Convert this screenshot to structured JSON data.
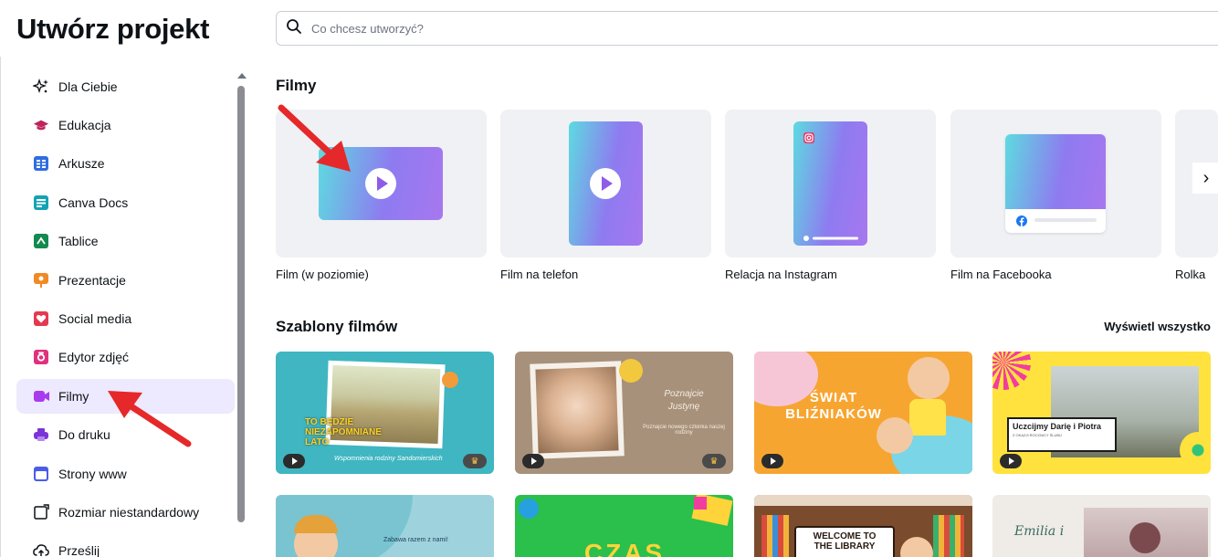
{
  "header": {
    "title": "Utwórz projekt",
    "search_placeholder": "Co chcesz utworzyć?"
  },
  "sidebar": {
    "items": [
      {
        "label": "Dla Ciebie",
        "icon": "sparkle-icon"
      },
      {
        "label": "Edukacja",
        "icon": "graduation-cap-icon"
      },
      {
        "label": "Arkusze",
        "icon": "sheet-icon"
      },
      {
        "label": "Canva Docs",
        "icon": "docs-icon"
      },
      {
        "label": "Tablice",
        "icon": "whiteboard-icon"
      },
      {
        "label": "Prezentacje",
        "icon": "presentation-icon"
      },
      {
        "label": "Social media",
        "icon": "heart-icon"
      },
      {
        "label": "Edytor zdjęć",
        "icon": "camera-icon"
      },
      {
        "label": "Filmy",
        "icon": "video-icon",
        "active": true
      },
      {
        "label": "Do druku",
        "icon": "printer-icon"
      },
      {
        "label": "Strony www",
        "icon": "website-icon"
      },
      {
        "label": "Rozmiar niestandardowy",
        "icon": "custom-size-icon"
      },
      {
        "label": "Prześlij",
        "icon": "upload-icon"
      }
    ]
  },
  "films": {
    "heading": "Filmy",
    "cards": [
      {
        "label": "Film (w poziomie)"
      },
      {
        "label": "Film na telefon"
      },
      {
        "label": "Relacja na Instagram"
      },
      {
        "label": "Film na Facebooka"
      },
      {
        "label": "Rolka"
      }
    ],
    "next_label": "›"
  },
  "templates": {
    "heading": "Szablony filmów",
    "see_all": "Wyświetl wszystko",
    "items": [
      {
        "line1": "TO BĘDZIE",
        "line2": "NIEZAPOMNIANE",
        "line3": "LATO",
        "script": "Wspomnienia rodziny Sandomierskich"
      },
      {
        "line1": "Poznajcie",
        "line2": "Justynę",
        "line3": "Poznajcie nowego członka naszej rodziny"
      },
      {
        "line1": "ŚWIAT",
        "line2": "BLIŹNIAKÓW"
      },
      {
        "line1": "Uczcijmy Darię i Piotra",
        "line2": "Z OKAZJI ROCZNICY ŚLUBU"
      },
      {
        "line1": "Zabawa razem z nami!"
      },
      {
        "line1": "CZAS"
      },
      {
        "line1": "WELCOME TO",
        "line2": "THE LIBRARY"
      },
      {
        "line1": "Emilia i"
      }
    ]
  },
  "colors": {
    "accent": "#8b3dff",
    "active_bg": "#ede9fe",
    "annotation_arrow": "#e5282a"
  }
}
